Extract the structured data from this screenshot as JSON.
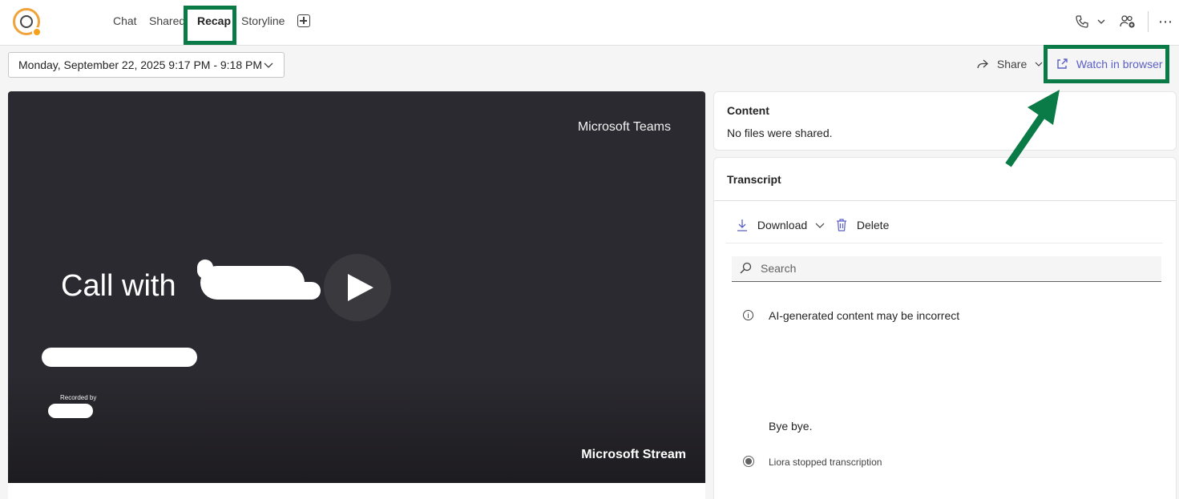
{
  "tabs": [
    {
      "label": "Chat"
    },
    {
      "label": "Shared"
    },
    {
      "label": "Recap"
    },
    {
      "label": "Storyline"
    }
  ],
  "date_range": "Monday, September 22, 2025 9:17 PM - 9:18 PM",
  "actions": {
    "share_label": "Share",
    "watch_label": "Watch in browser"
  },
  "video": {
    "brand_top": "Microsoft Teams",
    "call_title": "Call with",
    "recorded_by": "Recorded by",
    "brand_bottom": "Microsoft Stream"
  },
  "content": {
    "title": "Content",
    "text": "No files were shared."
  },
  "transcript": {
    "title": "Transcript",
    "download_label": "Download",
    "delete_label": "Delete",
    "search_placeholder": "Search",
    "ai_notice": "AI-generated content may be incorrect",
    "line": "Bye bye.",
    "stopped": "Liora stopped transcription"
  },
  "colors": {
    "accent": "#5b5fc7",
    "highlight": "#0a7a47"
  }
}
